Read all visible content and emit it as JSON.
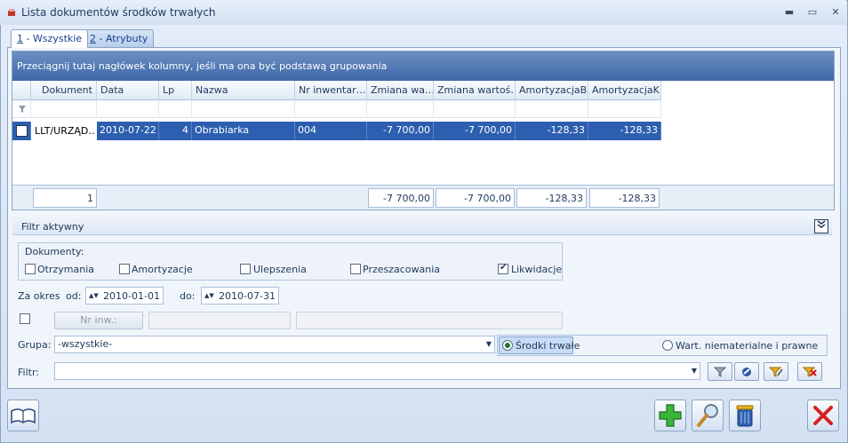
{
  "window": {
    "title": "Lista dokumentów środków trwałych",
    "controls": [
      "▬",
      "▭",
      "✕"
    ]
  },
  "tabs": [
    {
      "key": "1",
      "rest": " - Wszystkie"
    },
    {
      "key": "2",
      "rest": " - Atrybuty"
    }
  ],
  "grid": {
    "group_hint": "Przeciągnij tutaj nagłówek kolumny, jeśli ma ona być podstawą grupowania",
    "columns": [
      "Dokument",
      "Data",
      "Lp",
      "Nazwa",
      "Nr inwentar…",
      "Zmiana wa…",
      "Zmiana wartoś…",
      "AmortyzacjaB",
      "AmortyzacjaK"
    ],
    "rows": [
      {
        "dokument": "LLT/URZĄD…",
        "data": "2010-07-22",
        "lp": "4",
        "nazwa": "Obrabiarka",
        "nr_inw": "004",
        "zmiana_wa": "-7 700,00",
        "zmiana_wartosci": "-7 700,00",
        "amort_b": "-128,33",
        "amort_k": "-128,33"
      }
    ],
    "footer": {
      "count": "1",
      "zmiana_wa": "-7 700,00",
      "zmiana_wartosci": "-7 700,00",
      "amort_b": "-128,33",
      "amort_k": "-128,33"
    }
  },
  "filter": {
    "header": "Filtr aktywny",
    "documents_title": "Dokumenty:",
    "documents": [
      {
        "label": "Otrzymania",
        "checked": false
      },
      {
        "label": "Amortyzacje",
        "checked": false
      },
      {
        "label": "Ulepszenia",
        "checked": false
      },
      {
        "label": "Przeszacowania",
        "checked": false
      },
      {
        "label": "Likwidacje",
        "checked": true
      }
    ],
    "period_label": "Za okres",
    "from_label": "od:",
    "from_value": "2010-01-01",
    "to_label": "do:",
    "to_value": "2010-07-31",
    "inv_button": "Nr inw.:",
    "group_label": "Grupa:",
    "group_value": "-wszystkie-",
    "radio_fixed": "Środki trwałe",
    "radio_intangible": "Wart. niematerialne i prawne",
    "filter_label": "Filtr:",
    "filter_value": ""
  }
}
